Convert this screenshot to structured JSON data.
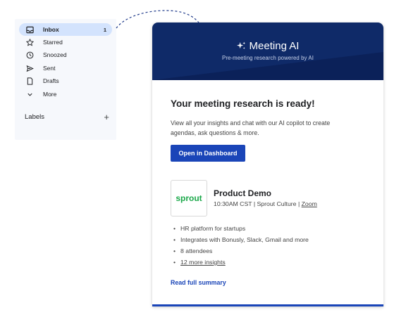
{
  "mail": {
    "nav": [
      {
        "label": "Inbox",
        "icon": "inbox-icon",
        "count": "1",
        "active": true
      },
      {
        "label": "Starred",
        "icon": "star-icon"
      },
      {
        "label": "Snoozed",
        "icon": "clock-icon"
      },
      {
        "label": "Sent",
        "icon": "send-icon"
      },
      {
        "label": "Drafts",
        "icon": "draft-icon"
      },
      {
        "label": "More",
        "icon": "chevron-down-icon"
      }
    ],
    "labels_heading": "Labels"
  },
  "card": {
    "brand": "Meeting AI",
    "tagline": "Pre-meeting research powered by AI",
    "title": "Your meeting research is ready!",
    "description": "View all your insights and chat with our AI copilot to create agendas, ask questions & more.",
    "cta_label": "Open in Dashboard",
    "logo_text": "sprout",
    "event": {
      "title": "Product Demo",
      "time": "10:30AM CST",
      "company": "Sprout Culture",
      "platform": "Zoom"
    },
    "bullets": [
      "HR platform for startups",
      "Integrates with Bonusly, Slack, Gmail and more",
      "8 attendees",
      "12 more insights"
    ],
    "summary_link": "Read full summary"
  },
  "colors": {
    "header_bg": "#0f2a68",
    "accent": "#1a45b8",
    "inbox_active": "#d3e3fd",
    "sprout_green": "#1ba84a"
  }
}
